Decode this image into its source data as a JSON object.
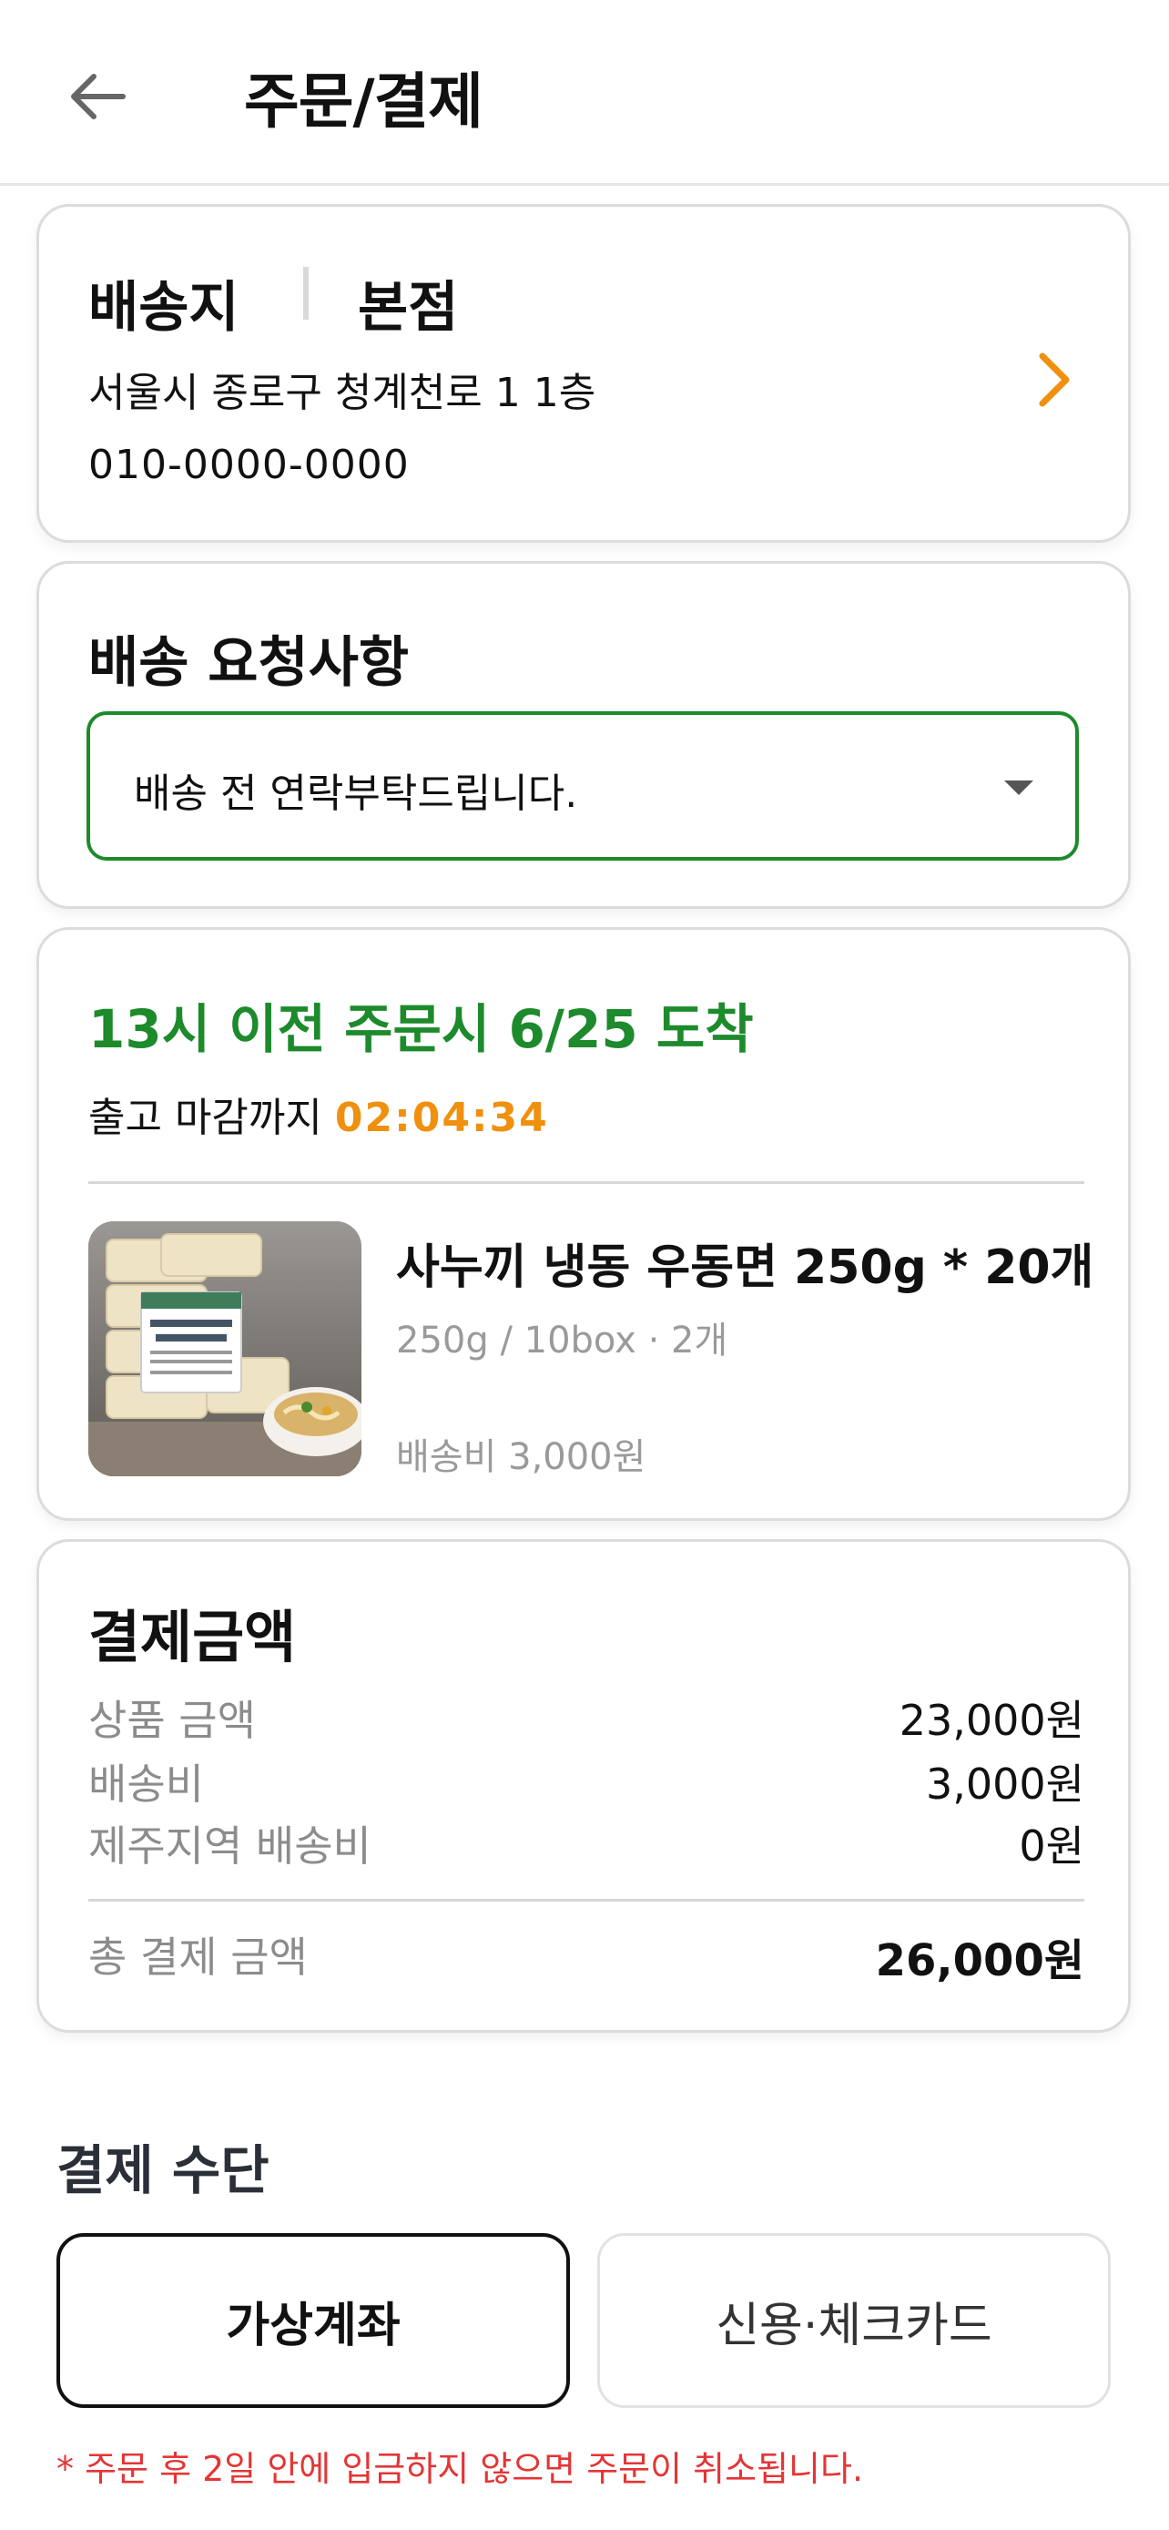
{
  "header": {
    "title": "주문/결제",
    "back_icon": "back-arrow-icon"
  },
  "address": {
    "label": "배송지",
    "name": "본점",
    "line": "서울시 종로구 청계천로 1 1층",
    "phone": "010-0000-0000",
    "chevron_icon": "chevron-right-icon",
    "chevron_color": "#F0900F"
  },
  "delivery_request": {
    "title": "배송 요청사항",
    "selected": "배송 전 연락부탁드립니다.",
    "caret_icon": "caret-down-icon",
    "border_color": "#1D8A2C"
  },
  "shipping": {
    "arrival": "13시 이전 주문시 6/25 도착",
    "cutoff_label": "출고 마감까지",
    "cutoff_time": "02:04:34",
    "product": {
      "name": "사누끼 냉동 우동면 250g * 20개",
      "option": "250g / 10box · 2개",
      "shipping_fee": "배송비 3,000원",
      "image_icon": "udon-product-image"
    }
  },
  "payment": {
    "title": "결제금액",
    "rows": [
      {
        "label": "상품 금액",
        "value": "23,000원"
      },
      {
        "label": "배송비",
        "value": "3,000원"
      },
      {
        "label": "제주지역 배송비",
        "value": "0원"
      }
    ],
    "total_label": "총 결제 금액",
    "total_value": "26,000원"
  },
  "method": {
    "title": "결제 수단",
    "options": [
      "가상계좌",
      "신용·체크카드"
    ],
    "selected": "가상계좌",
    "notice": "* 주문 후 2일 안에 입금하지 않으면 주문이 취소됩니다."
  },
  "colors": {
    "green": "#1D8A2C",
    "orange": "#F0900F",
    "red": "#E43535"
  }
}
